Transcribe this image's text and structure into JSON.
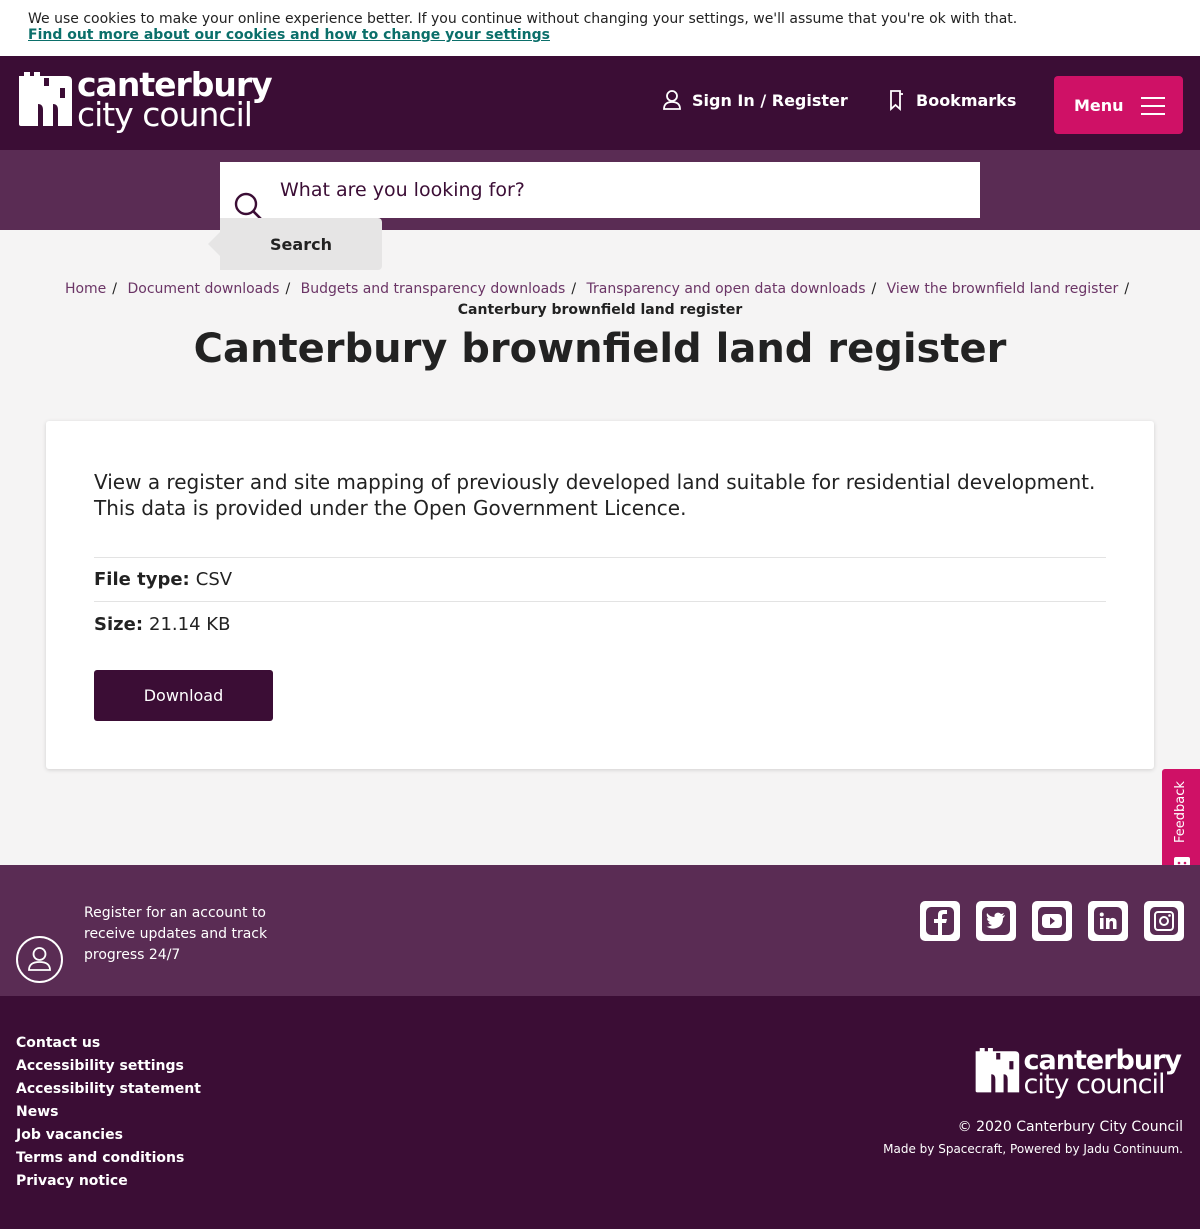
{
  "cookie": {
    "message": "We use cookies to make your online experience better. If you continue without changing your settings, we'll assume that you're ok with that.",
    "link": "Find out more about our cookies and how to change your settings"
  },
  "header": {
    "logo_line1": "canterbury",
    "logo_line2": "city council",
    "signin": "Sign In / Register",
    "bookmarks": "Bookmarks",
    "menu": "Menu"
  },
  "search": {
    "placeholder": "What are you looking for?",
    "button": "Search"
  },
  "breadcrumb": {
    "items": [
      "Home",
      "Document downloads",
      "Budgets and transparency downloads",
      "Transparency and open data downloads",
      "View the brownfield land register"
    ],
    "separator": "/",
    "current": "Canterbury brownfield land register"
  },
  "page": {
    "title": "Canterbury brownfield land register",
    "description": "View a register and site mapping of previously developed land suitable for residential development. This data is provided under the Open Government Licence.",
    "file_type_label": "File type:",
    "file_type": "CSV",
    "size_label": "Size:",
    "size": "21.14 KB",
    "download": "Download"
  },
  "feedback": {
    "label": "Feedback"
  },
  "footer_top": {
    "register_text": "Register for an account to receive updates and track progress 24/7",
    "social": [
      "facebook-icon",
      "twitter-icon",
      "youtube-icon",
      "linkedin-icon",
      "instagram-icon"
    ]
  },
  "footer": {
    "links": [
      "Contact us",
      "Accessibility settings",
      "Accessibility statement",
      "News",
      "Job vacancies",
      "Terms and conditions",
      "Privacy notice"
    ],
    "logo_line1": "canterbury",
    "logo_line2": "city council",
    "copyright": "© 2020 Canterbury City Council",
    "madeby": "Made by Spacecraft, Powered by Jadu Continuum."
  },
  "colors": {
    "brand_purple": "#3b0d35",
    "band_purple": "#5a2c54",
    "accent_pink": "#cf1166",
    "link_teal": "#0b6f6a"
  }
}
